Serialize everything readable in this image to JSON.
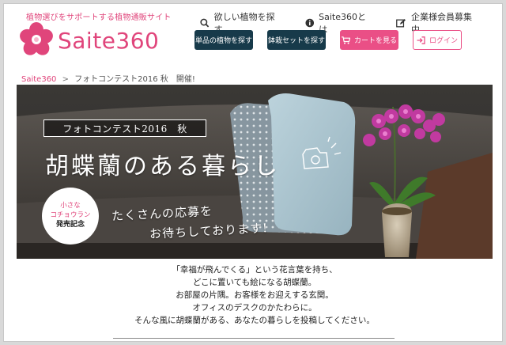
{
  "header": {
    "tagline": "植物選びをサポートする植物通販サイト",
    "logo_text": "Saite360",
    "brand_color": "#e0457b"
  },
  "topnav": [
    {
      "label": "欲しい植物を探す",
      "icon": "search-icon"
    },
    {
      "label": "Saite360とは",
      "icon": "info-icon"
    },
    {
      "label": "企業様会員募集中",
      "icon": "edit-icon"
    }
  ],
  "buttons": {
    "single_plants": "単品の植物を探す",
    "potted_sets": "鉢栽セットを探す",
    "cart": "カートを見る",
    "login": "ログイン"
  },
  "breadcrumb": {
    "home": "Saite360",
    "separator": ">",
    "current": "フォトコンテスト2016 秋　開催!"
  },
  "hero": {
    "contest_label": "フォトコンテスト2016　秋",
    "title": "胡蝶蘭のある暮らし",
    "subtitle_line1": "たくさんの応募を",
    "subtitle_line2": "お待ちしております!",
    "badge_line1": "小さな",
    "badge_line2": "コチョウラン",
    "badge_line3": "発売記念"
  },
  "intro": {
    "lines": [
      "「幸福が飛んでくる」という花言葉を持ち、",
      "どこに置いても絵になる胡蝶蘭。",
      "お部屋の片隅。お客様をお迎えする玄関。",
      "オフィスのデスクのかたわらに。",
      "そんな風に胡蝶蘭がある、あなたの暮らしを投稿してください。"
    ]
  }
}
